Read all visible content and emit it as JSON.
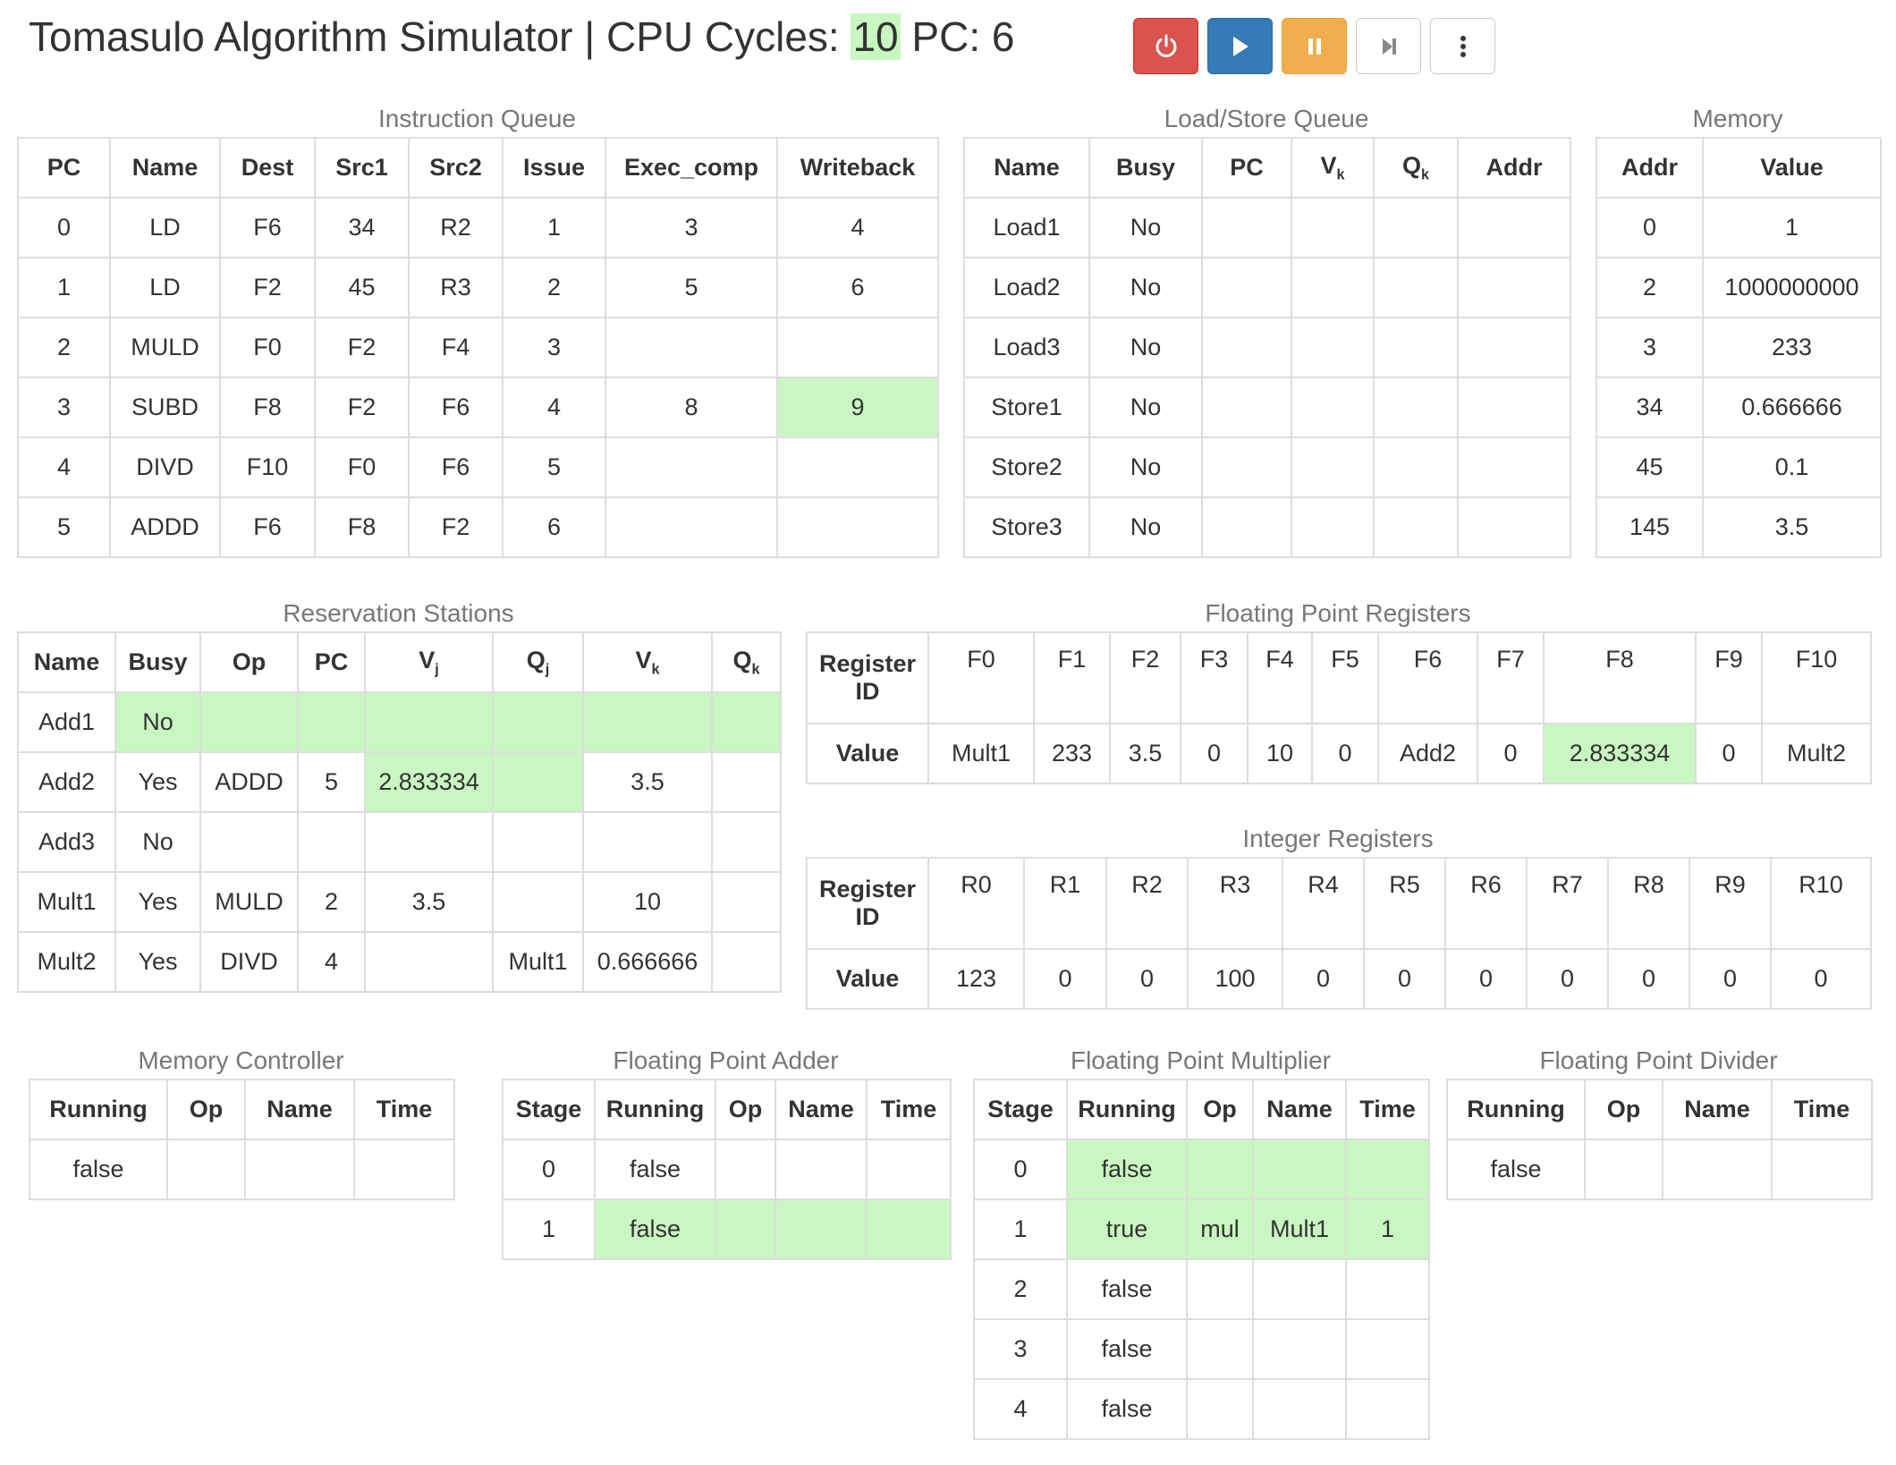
{
  "header": {
    "title_prefix": "Tomasulo Algorithm Simulator | CPU Cycles:",
    "cycles": "10",
    "pc_text": "PC: 6"
  },
  "toolbar": {
    "reset_icon": "power-icon",
    "run_icon": "play-icon",
    "pause_icon": "pause-icon",
    "step_icon": "step-forward-icon",
    "more_icon": "vertical-ellipsis-icon",
    "colors": {
      "reset": "#d9534f",
      "run": "#337ab7",
      "pause": "#f0ad4e",
      "highlight": "#c9f7c1"
    }
  },
  "instruction_queue": {
    "title": "Instruction Queue",
    "headers": [
      "PC",
      "Name",
      "Dest",
      "Src1",
      "Src2",
      "Issue",
      "Exec_comp",
      "Writeback"
    ],
    "rows": [
      [
        "0",
        "LD",
        "F6",
        "34",
        "R2",
        "1",
        "3",
        "4"
      ],
      [
        "1",
        "LD",
        "F2",
        "45",
        "R3",
        "2",
        "5",
        "6"
      ],
      [
        "2",
        "MULD",
        "F0",
        "F2",
        "F4",
        "3",
        "",
        ""
      ],
      [
        "3",
        "SUBD",
        "F8",
        "F2",
        "F6",
        "4",
        "8",
        "9"
      ],
      [
        "4",
        "DIVD",
        "F10",
        "F0",
        "F6",
        "5",
        "",
        ""
      ],
      [
        "5",
        "ADDD",
        "F6",
        "F8",
        "F2",
        "6",
        "",
        ""
      ]
    ]
  },
  "load_store_queue": {
    "title": "Load/Store Queue",
    "headers": [
      "Name",
      "Busy",
      "PC",
      "V",
      "Q",
      "Addr"
    ],
    "header_subs": [
      "",
      "",
      "",
      "k",
      "k",
      ""
    ],
    "rows": [
      [
        "Load1",
        "No",
        "",
        "",
        "",
        ""
      ],
      [
        "Load2",
        "No",
        "",
        "",
        "",
        ""
      ],
      [
        "Load3",
        "No",
        "",
        "",
        "",
        ""
      ],
      [
        "Store1",
        "No",
        "",
        "",
        "",
        ""
      ],
      [
        "Store2",
        "No",
        "",
        "",
        "",
        ""
      ],
      [
        "Store3",
        "No",
        "",
        "",
        "",
        ""
      ]
    ]
  },
  "memory": {
    "title": "Memory",
    "headers": [
      "Addr",
      "Value"
    ],
    "rows": [
      [
        "0",
        "1"
      ],
      [
        "2",
        "1000000000"
      ],
      [
        "3",
        "233"
      ],
      [
        "34",
        "0.666666"
      ],
      [
        "45",
        "0.1"
      ],
      [
        "145",
        "3.5"
      ]
    ]
  },
  "reservation_stations": {
    "title": "Reservation Stations",
    "headers": [
      "Name",
      "Busy",
      "Op",
      "PC",
      "V",
      "Q",
      "V",
      "Q"
    ],
    "header_subs": [
      "",
      "",
      "",
      "",
      "j",
      "j",
      "k",
      "k"
    ],
    "rows": [
      [
        "Add1",
        "No",
        "",
        "",
        "",
        "",
        "",
        ""
      ],
      [
        "Add2",
        "Yes",
        "ADDD",
        "5",
        "2.833334",
        "",
        "3.5",
        ""
      ],
      [
        "Add3",
        "No",
        "",
        "",
        "",
        "",
        "",
        ""
      ],
      [
        "Mult1",
        "Yes",
        "MULD",
        "2",
        "3.5",
        "",
        "10",
        ""
      ],
      [
        "Mult2",
        "Yes",
        "DIVD",
        "4",
        "",
        "Mult1",
        "0.666666",
        ""
      ]
    ]
  },
  "fp_registers": {
    "title": "Floating Point Registers",
    "id_label": "Register ID",
    "value_label": "Value",
    "ids": [
      "F0",
      "F1",
      "F2",
      "F3",
      "F4",
      "F5",
      "F6",
      "F7",
      "F8",
      "F9",
      "F10"
    ],
    "values": [
      "Mult1",
      "233",
      "3.5",
      "0",
      "10",
      "0",
      "Add2",
      "0",
      "2.833334",
      "0",
      "Mult2"
    ]
  },
  "int_registers": {
    "title": "Integer Registers",
    "id_label": "Register ID",
    "value_label": "Value",
    "ids": [
      "R0",
      "R1",
      "R2",
      "R3",
      "R4",
      "R5",
      "R6",
      "R7",
      "R8",
      "R9",
      "R10"
    ],
    "values": [
      "123",
      "0",
      "0",
      "100",
      "0",
      "0",
      "0",
      "0",
      "0",
      "0",
      "0"
    ]
  },
  "memory_controller": {
    "title": "Memory Controller",
    "headers": [
      "Running",
      "Op",
      "Name",
      "Time"
    ],
    "rows": [
      [
        "false",
        "",
        "",
        ""
      ]
    ]
  },
  "fp_adder": {
    "title": "Floating Point Adder",
    "headers": [
      "Stage",
      "Running",
      "Op",
      "Name",
      "Time"
    ],
    "rows": [
      [
        "0",
        "false",
        "",
        "",
        ""
      ],
      [
        "1",
        "false",
        "",
        "",
        ""
      ]
    ]
  },
  "fp_multiplier": {
    "title": "Floating Point Multiplier",
    "headers": [
      "Stage",
      "Running",
      "Op",
      "Name",
      "Time"
    ],
    "rows": [
      [
        "0",
        "false",
        "",
        "",
        ""
      ],
      [
        "1",
        "true",
        "mul",
        "Mult1",
        "1"
      ],
      [
        "2",
        "false",
        "",
        "",
        ""
      ],
      [
        "3",
        "false",
        "",
        "",
        ""
      ],
      [
        "4",
        "false",
        "",
        "",
        ""
      ]
    ]
  },
  "fp_divider": {
    "title": "Floating Point Divider",
    "headers": [
      "Running",
      "Op",
      "Name",
      "Time"
    ],
    "rows": [
      [
        "false",
        "",
        "",
        ""
      ]
    ]
  }
}
